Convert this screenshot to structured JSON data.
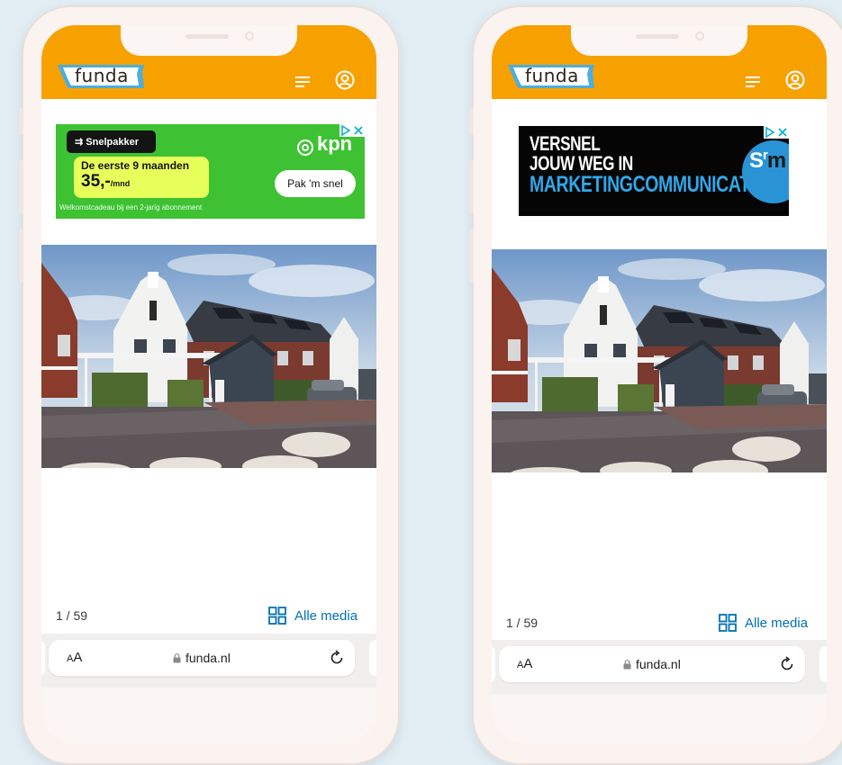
{
  "phones": [
    {
      "header": {
        "logo_text": "funda",
        "menu_icon": "menu-icon",
        "account_icon": "user-icon",
        "brand_color": "#f7a100"
      },
      "ad": {
        "type": "kpn",
        "tag": "Snelpakker",
        "offer_line": "De eerste 9 maanden",
        "price": "35,-",
        "price_unit": "/mnd",
        "fine_print": "Welkomstcadeau bij een 2-jarig abonnement",
        "cta": "Pak 'm snel",
        "brand": "kpn"
      },
      "gallery": {
        "counter": "1 / 59",
        "all_media": "Alle media"
      },
      "browser": {
        "text_size": "AA",
        "domain": "funda.nl"
      }
    },
    {
      "header": {
        "logo_text": "funda",
        "menu_icon": "menu-icon",
        "account_icon": "user-icon",
        "brand_color": "#f7a100"
      },
      "ad": {
        "type": "srm",
        "line1": "VERSNEL",
        "line2": "JOUW WEG IN",
        "line3": "MARKETINGCOMMUNICATIE",
        "logo_s": "S",
        "logo_r": "r",
        "logo_m": "m"
      },
      "gallery": {
        "counter": "1 / 59",
        "all_media": "Alle media"
      },
      "browser": {
        "text_size": "AA",
        "domain": "funda.nl"
      }
    }
  ]
}
